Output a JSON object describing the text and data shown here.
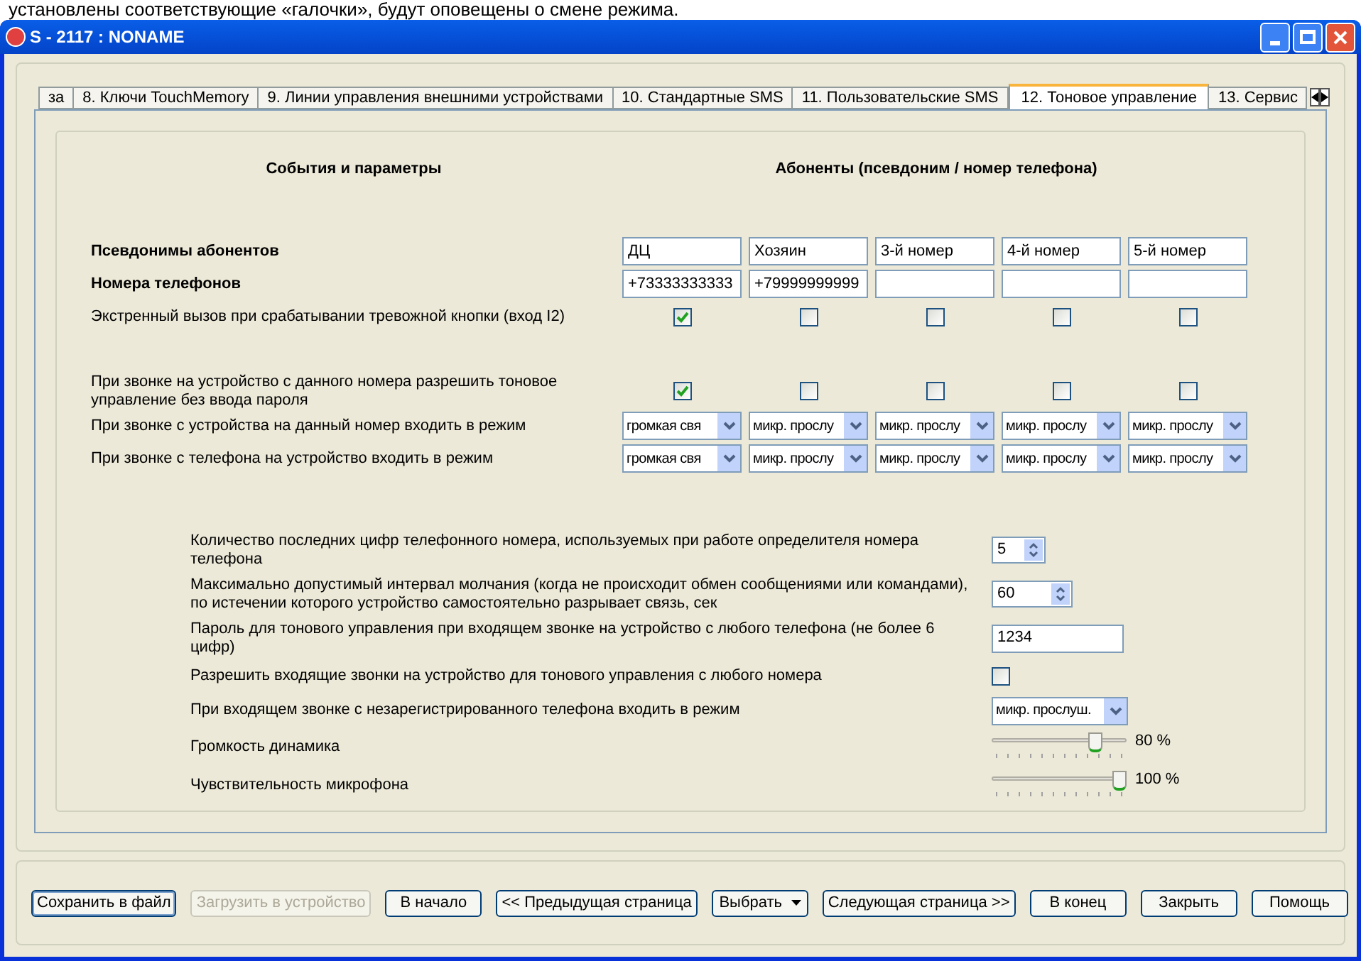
{
  "background_text": "установлены соответствующие «галочки», будут оповещены о смене режима.",
  "window": {
    "title": "S - 2117 : NONAME"
  },
  "tabs": [
    {
      "label": "за",
      "selected": false
    },
    {
      "label": "8. Ключи TouchMemory",
      "selected": false
    },
    {
      "label": "9. Линии управления внешними устройствами",
      "selected": false
    },
    {
      "label": "10. Стандартные SMS",
      "selected": false
    },
    {
      "label": "11. Пользовательские SMS",
      "selected": false
    },
    {
      "label": "12. Тоновое управление",
      "selected": true
    },
    {
      "label": "13. Сервис",
      "selected": false
    }
  ],
  "headers": {
    "events": "События и параметры",
    "subscribers": "Абоненты (псевдоним / номер телефона)"
  },
  "subscriber_rows": [
    {
      "kind": "text",
      "label": "Псевдонимы абонентов",
      "bold": true,
      "values": [
        "ДЦ",
        "Хозяин",
        "3-й номер",
        "4-й номер",
        "5-й номер"
      ]
    },
    {
      "kind": "text",
      "label": "Номера телефонов",
      "bold": true,
      "values": [
        "+73333333333",
        "+79999999999"
      ]
    },
    {
      "kind": "checkbox",
      "label": "Экстренный вызов при срабатывании тревожной кнопки (вход I2)",
      "bold": false,
      "checked": [
        true,
        false,
        false,
        false,
        false
      ]
    },
    {
      "kind": "checkbox",
      "label": "При звонке на устройство с данного номера разрешить тоновое управление без ввода пароля",
      "bold": false,
      "checked": [
        true,
        false,
        false,
        false,
        false
      ]
    },
    {
      "kind": "select",
      "label": "При звонке с устройства на данный номер входить в режим",
      "bold": false,
      "values": [
        "громкая свя",
        "микр. прослу",
        "микр. прослу",
        "микр. прослу",
        "микр. прослу"
      ]
    },
    {
      "kind": "select",
      "label": "При звонке с телефона на устройство входить в режим",
      "bold": false,
      "values": [
        "громкая свя",
        "микр. прослу",
        "микр. прослу",
        "микр. прослу",
        "микр. прослу"
      ]
    }
  ],
  "settings": [
    {
      "kind": "spin",
      "label": "Количество последних цифр телефонного номера, используемых при работе определителя номера телефона",
      "value": "5"
    },
    {
      "kind": "spin",
      "label": "Максимально допустимый интервал молчания (когда не происходит обмен сообщениями или командами), по истечении которого устройство самостоятельно разрывает связь, сек",
      "value": "60"
    },
    {
      "kind": "text",
      "label": "Пароль для тонового управления при входящем звонке на устройство с любого телефона (не более 6 цифр)",
      "value": "1234"
    },
    {
      "kind": "checkbox",
      "label": "Разрешить входящие звонки на устройство для тонового управления с любого номера",
      "checked": false
    },
    {
      "kind": "select",
      "label": "При входящем звонке с незарегистрированного телефона входить в режим",
      "value": "микр. прослуш."
    },
    {
      "kind": "slider",
      "label": "Громкость динамика",
      "level": 0.8,
      "reading": "80 %"
    },
    {
      "kind": "slider",
      "label": "Чувствительность микрофона",
      "level": 1.0,
      "reading": "100 %"
    }
  ],
  "buttons": [
    {
      "label": "Сохранить в файл",
      "disabled": false,
      "kind": "plain"
    },
    {
      "label": "Загрузить в устройство",
      "disabled": true,
      "kind": "plain"
    },
    {
      "label": "В начало",
      "disabled": false,
      "kind": "plain"
    },
    {
      "label": "<< Предыдущая страница",
      "disabled": false,
      "kind": "plain"
    },
    {
      "label": "Выбрать",
      "disabled": false,
      "kind": "menu"
    },
    {
      "label": "Следующая страница >>",
      "disabled": false,
      "kind": "plain"
    },
    {
      "label": "В конец",
      "disabled": false,
      "kind": "plain"
    },
    {
      "label": "Закрыть",
      "disabled": false,
      "kind": "plain"
    },
    {
      "label": "Помощь",
      "disabled": false,
      "kind": "plain"
    }
  ]
}
